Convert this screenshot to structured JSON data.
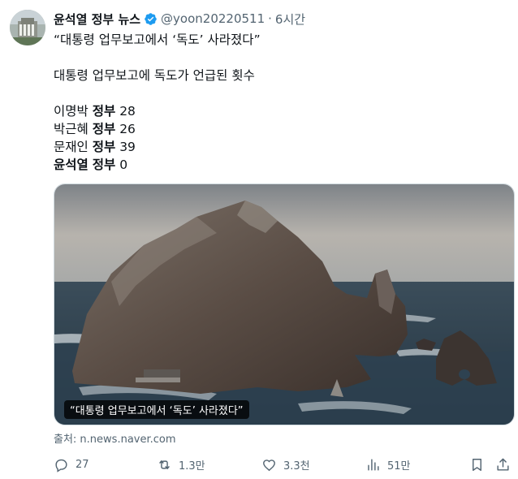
{
  "tweet": {
    "author": "윤석열 정부 뉴스",
    "handle": "@yoon20220511",
    "separator": "·",
    "time": "6시간",
    "quote_title": "“대통령 업무보고에서 ‘독도’ 사라졌다”",
    "subtitle": "대통령 업무보고에 독도가 언급된 횟수",
    "stats": [
      {
        "name": "이명박",
        "gov": "정부",
        "count": "28"
      },
      {
        "name": "박근혜",
        "gov": "정부",
        "count": "26"
      },
      {
        "name": "문재인",
        "gov": "정부",
        "count": "39"
      },
      {
        "name": "윤석열",
        "gov": "정부",
        "count": "0"
      }
    ],
    "media_caption": "“대통령 업무보고에서 ‘독도’ 사라졌다”",
    "source": "출처: n.news.naver.com"
  },
  "actions": {
    "reply_count": "27",
    "retweet_count": "1.3만",
    "like_count": "3.3천",
    "views_count": "51만"
  },
  "colors": {
    "text": "#0f1419",
    "muted": "#536471",
    "verified": "#1d9bf0"
  },
  "icons": [
    "verified-badge-icon",
    "reply-icon",
    "retweet-icon",
    "like-icon",
    "views-icon",
    "bookmark-icon",
    "share-icon"
  ]
}
